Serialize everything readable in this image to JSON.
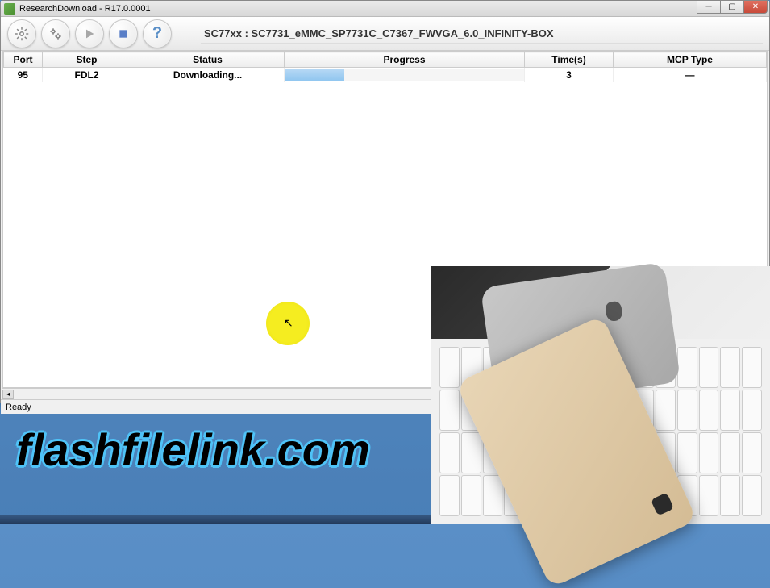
{
  "window": {
    "title": "ResearchDownload - R17.0.0001"
  },
  "toolbar": {
    "device_info": "SC77xx : SC7731_eMMC_SP7731C_C7367_FWVGA_6.0_INFINITY-BOX"
  },
  "table": {
    "headers": {
      "port": "Port",
      "step": "Step",
      "status": "Status",
      "progress": "Progress",
      "time": "Time(s)",
      "mcp": "MCP Type"
    },
    "rows": [
      {
        "port": "95",
        "step": "FDL2",
        "status": "Downloading...",
        "progress_pct": 25,
        "time": "3",
        "mcp": "—"
      }
    ]
  },
  "statusbar": {
    "text": "Ready"
  },
  "watermark": "flashfilelink.com"
}
